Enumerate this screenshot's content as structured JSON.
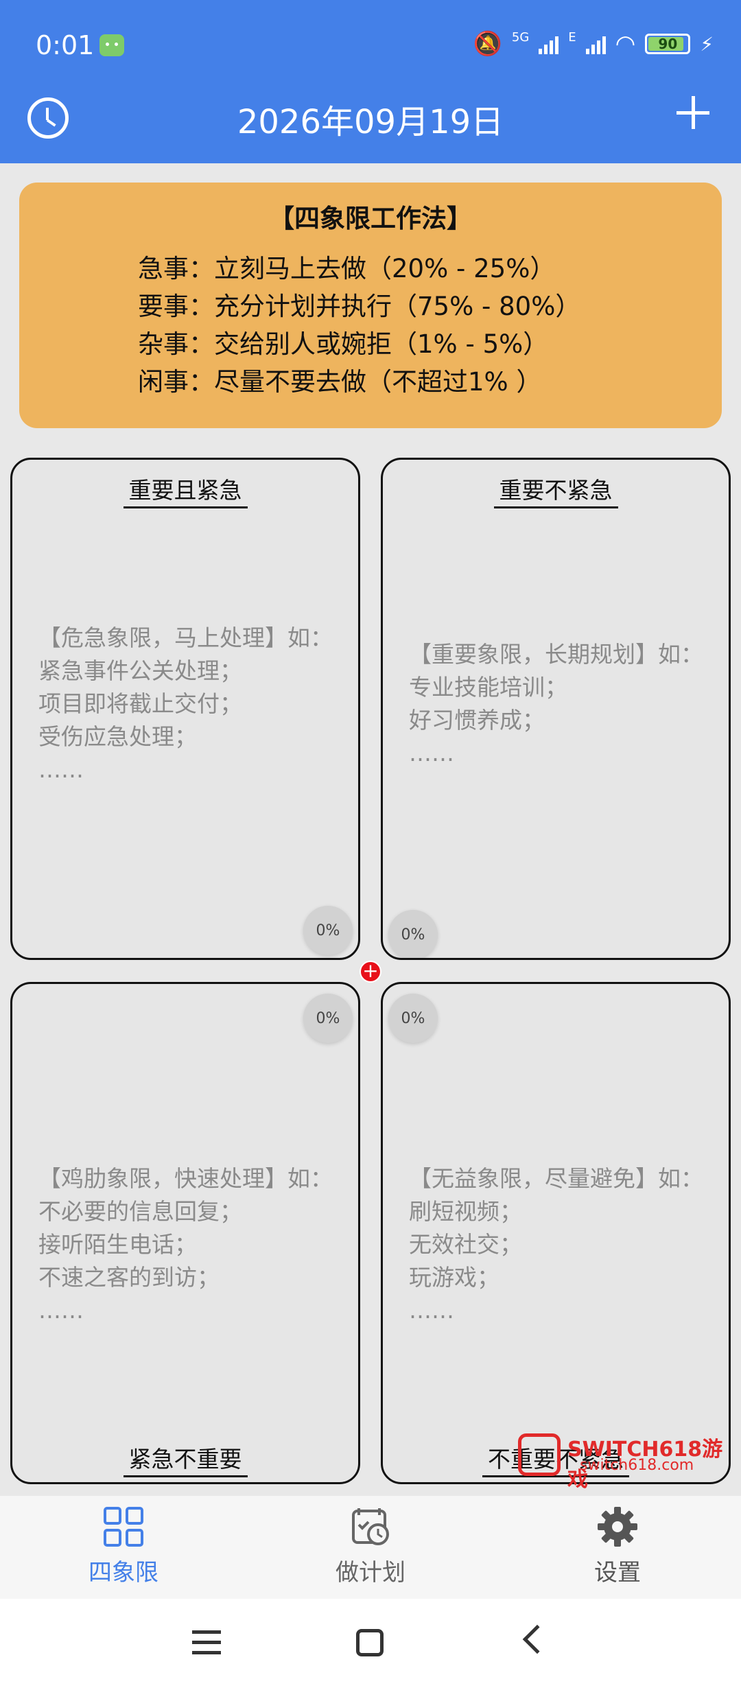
{
  "status_bar": {
    "time": "0:01",
    "battery": "90",
    "battery_level_percent": 90,
    "network": "5G",
    "network2": "E"
  },
  "app_bar": {
    "title": "2026年09月19日"
  },
  "method_card": {
    "title": "【四象限工作法】",
    "lines": [
      "急事：立刻马上去做（20% - 25%）",
      "要事：充分计划并执行（75% - 80%）",
      "杂事：交给别人或婉拒（1% - 5%）",
      "闲事：尽量不要去做（不超过1% ）"
    ]
  },
  "quadrants": [
    {
      "title": "重要且紧急",
      "percent": "0%",
      "hint_lines": [
        "【危急象限，马上处理】如：",
        "紧急事件公关处理；",
        "项目即将截止交付；",
        "受伤应急处理；",
        "……"
      ]
    },
    {
      "title": "重要不紧急",
      "percent": "0%",
      "hint_lines": [
        "【重要象限，长期规划】如：",
        "专业技能培训；",
        "好习惯养成；",
        "……"
      ]
    },
    {
      "title": "紧急不重要",
      "percent": "0%",
      "hint_lines": [
        "【鸡肋象限，快速处理】如：",
        "不必要的信息回复；",
        "接听陌生电话；",
        "不速之客的到访；",
        "……"
      ]
    },
    {
      "title": "不重要不紧急",
      "percent": "0%",
      "hint_lines": [
        "【无益象限，尽量避免】如：",
        "刷短视频；",
        "无效社交；",
        "玩游戏；",
        "……"
      ]
    }
  ],
  "center_button": "+",
  "watermark": {
    "text": "SWITCH618游戏",
    "url": "switch618.com"
  },
  "bottom_nav": {
    "items": [
      {
        "label": "四象限",
        "icon": "grid-icon",
        "active": true
      },
      {
        "label": "做计划",
        "icon": "calendar-clock-icon",
        "active": false
      },
      {
        "label": "设置",
        "icon": "gear-icon",
        "active": false
      }
    ]
  },
  "colors": {
    "primary": "#4480e8",
    "card": "#eeb45e",
    "quadrant_bg": "#e6e6e6",
    "accent_red": "#e8101a"
  }
}
